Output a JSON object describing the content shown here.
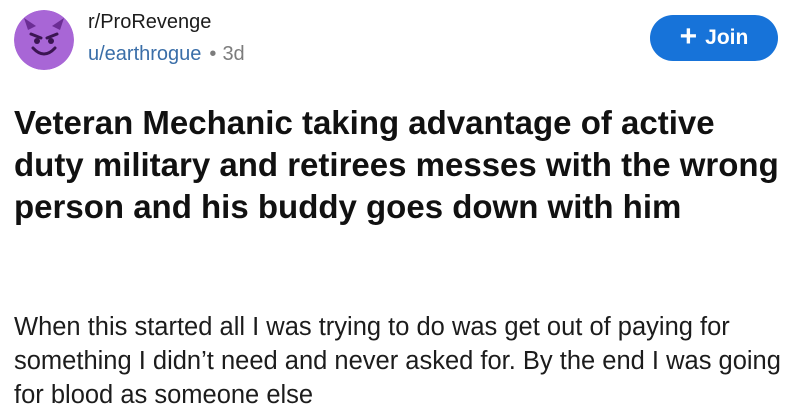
{
  "post": {
    "subreddit": "r/ProRevenge",
    "author": "u/earthrogue",
    "separator": "•",
    "age": "3d",
    "avatar_icon": "devil-face-icon",
    "join_label": "Join",
    "join_icon": "plus-icon",
    "accent_color": "#1773d9",
    "title": "Veteran Mechanic taking advantage of active duty military and retirees messes with the wrong person and his buddy goes down with him",
    "body": "When this started all I was trying to do was get out of paying for something I didn’t need and never asked for. By the end I was going for blood as someone else"
  }
}
